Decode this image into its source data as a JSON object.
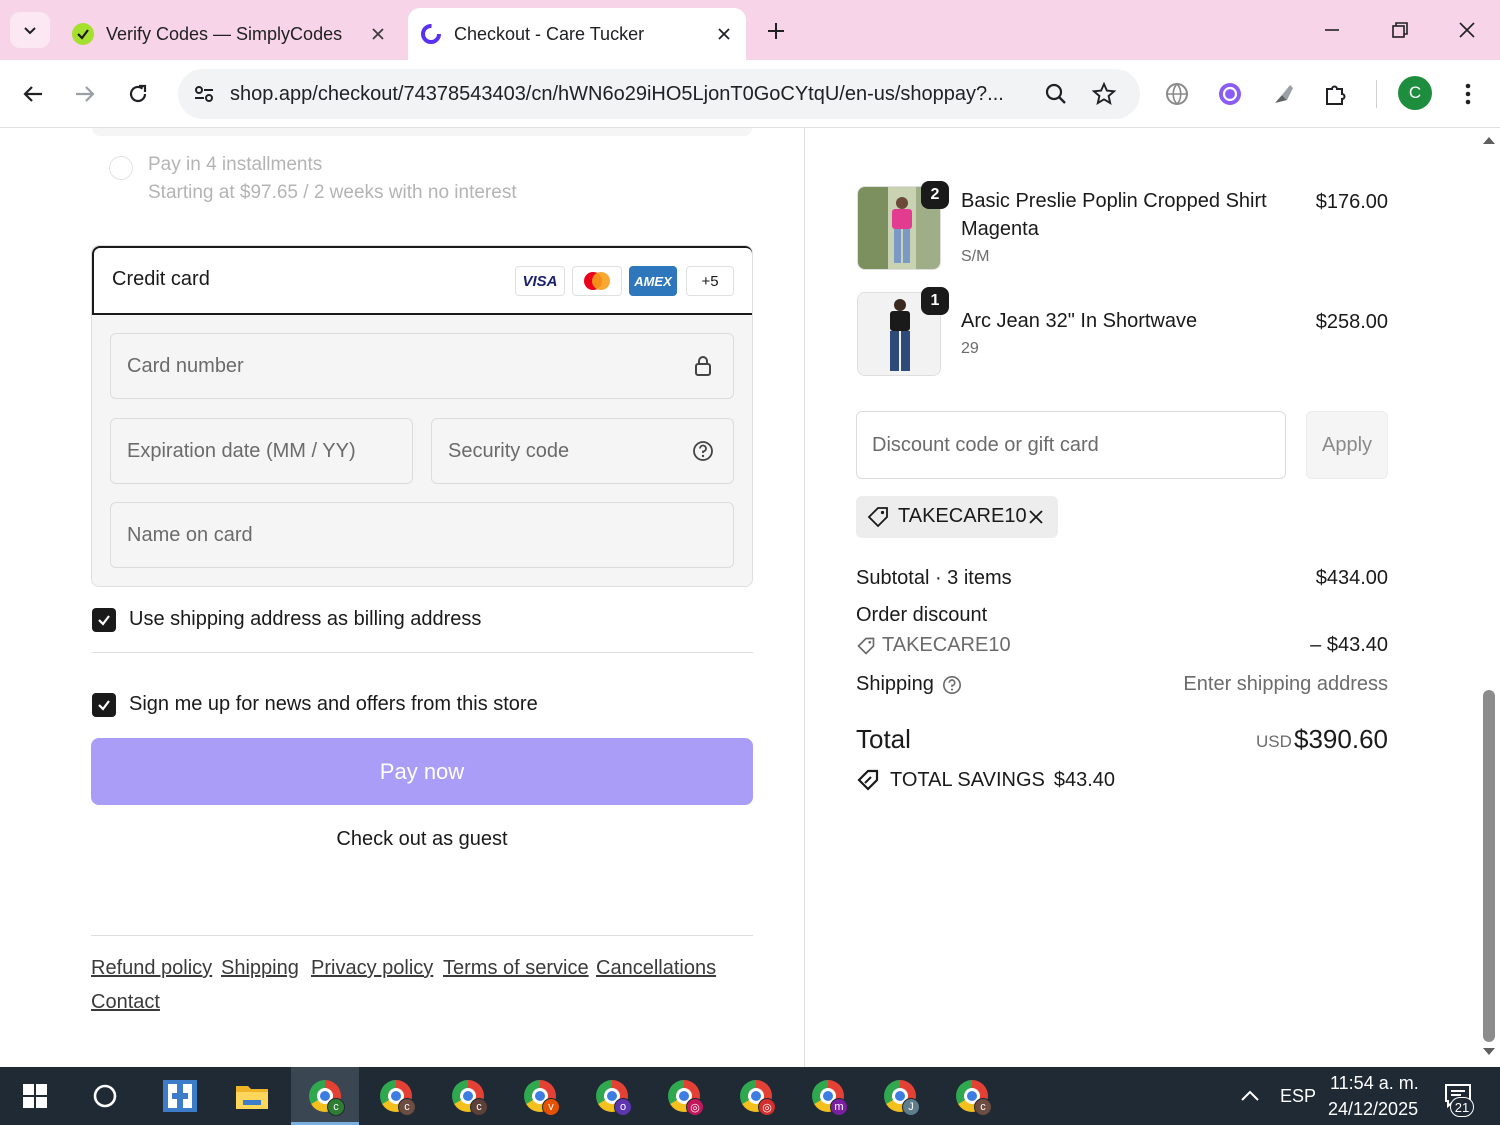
{
  "browser": {
    "tabs": [
      {
        "title": "Verify Codes — SimplyCodes",
        "active": false
      },
      {
        "title": "Checkout - Care Tucker",
        "active": true
      }
    ],
    "url": "shop.app/checkout/74378543403/cn/hWN6o29iHO5LjonT0GoCYtqU/en-us/shoppay?...",
    "profile_initial": "C"
  },
  "payment": {
    "installments_title": "Pay in 4 installments",
    "installments_sub": "Starting at $97.65 / 2 weeks with no interest",
    "credit_card_label": "Credit card",
    "card_logos": [
      "VISA",
      "Mastercard",
      "AMEX",
      "+5"
    ],
    "card_number_placeholder": "Card number",
    "expiration_placeholder": "Expiration date (MM / YY)",
    "security_placeholder": "Security code",
    "name_placeholder": "Name on card",
    "billing_checkbox_label": "Use shipping address as billing address",
    "billing_checked": true,
    "news_checkbox_label": "Sign me up for news and offers from this store",
    "news_checked": true,
    "pay_button": "Pay now",
    "guest_link": "Check out as guest"
  },
  "footer_links": [
    "Refund policy",
    "Shipping",
    "Privacy policy",
    "Terms of service",
    "Cancellations",
    "Contact"
  ],
  "order": {
    "items": [
      {
        "name_line1": "Basic Preslie Poplin Cropped Shirt",
        "name_line2": "Magenta",
        "variant": "S/M",
        "price": "$176.00",
        "qty": "2"
      },
      {
        "name_line1": "Arc Jean 32\" In Shortwave",
        "name_line2": "",
        "variant": "29",
        "price": "$258.00",
        "qty": "1"
      }
    ],
    "discount_placeholder": "Discount code or gift card",
    "apply_button": "Apply",
    "applied_code": "TAKECARE10",
    "subtotal_label": "Subtotal · 3 items",
    "subtotal_value": "$434.00",
    "order_discount_label": "Order discount",
    "discount_code": "TAKECARE10",
    "discount_value": "– $43.40",
    "shipping_label": "Shipping",
    "shipping_value": "Enter shipping address",
    "total_label": "Total",
    "currency": "USD",
    "total_value": "$390.60",
    "savings_label": "TOTAL SAVINGS",
    "savings_value": "$43.40"
  },
  "taskbar": {
    "apps": [
      {
        "name": "chrome-c",
        "badge": "c",
        "color": "#2e7d32"
      },
      {
        "name": "chrome-c",
        "badge": "c",
        "color": "#6d4c41"
      },
      {
        "name": "chrome-c",
        "badge": "c",
        "color": "#5d4037"
      },
      {
        "name": "chrome-v",
        "badge": "v",
        "color": "#e65100"
      },
      {
        "name": "chrome-o",
        "badge": "o",
        "color": "#5e35b1"
      },
      {
        "name": "chrome-p1",
        "badge": "◎",
        "color": "#c2185b"
      },
      {
        "name": "chrome-p2",
        "badge": "◎",
        "color": "#d32f2f"
      },
      {
        "name": "chrome-m",
        "badge": "m",
        "color": "#7b1fa2"
      },
      {
        "name": "chrome-j",
        "badge": "J",
        "color": "#607d8b"
      },
      {
        "name": "chrome-c",
        "badge": "c",
        "color": "#6d4c41"
      }
    ],
    "language": "ESP",
    "time": "11:54 a. m.",
    "date": "24/12/2025",
    "notification_count": "21"
  },
  "colors": {
    "tabstrip": "#f8d4e8",
    "pay_button": "#a99df7",
    "taskbar": "#1f2a35"
  }
}
